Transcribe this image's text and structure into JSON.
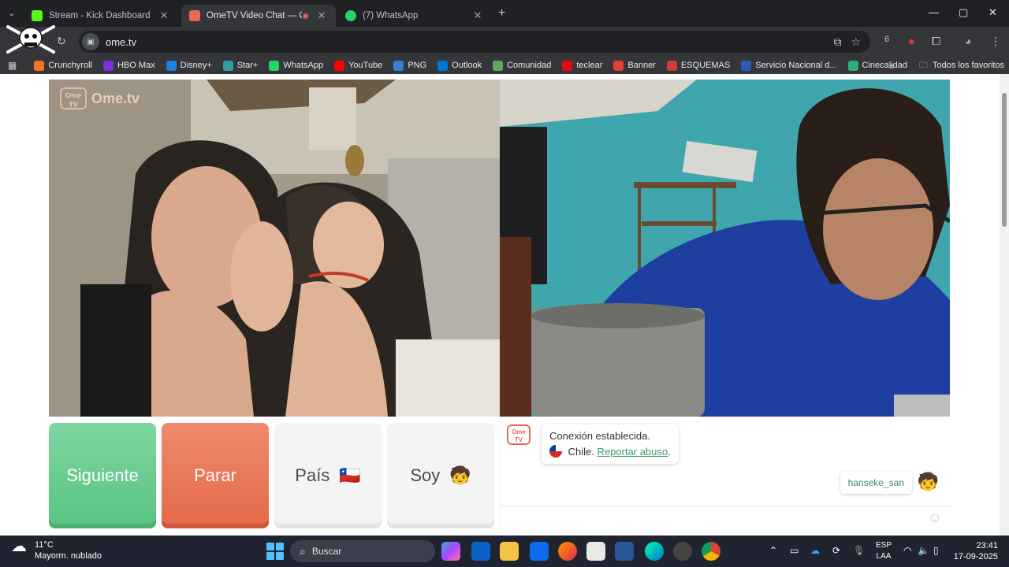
{
  "browser": {
    "tabs": [
      {
        "title": "Stream - Kick Dashboard",
        "color": "#53fc18"
      },
      {
        "title": "OmeTV Video Chat — Ome",
        "color": "#e8665a",
        "active": true
      },
      {
        "title": "(7) WhatsApp",
        "color": "#25d366"
      }
    ],
    "new_tab": "+",
    "url": "ome.tv",
    "window_controls": {
      "minimize": "—",
      "maximize": "▢",
      "close": "✕"
    }
  },
  "bookmarks": [
    {
      "label": "Crunchyroll",
      "color": "#f47521"
    },
    {
      "label": "HBO Max",
      "color": "#7b2fd6"
    },
    {
      "label": "Disney+",
      "color": "#1f80e0"
    },
    {
      "label": "Star+",
      "color": "#2ea0a0"
    },
    {
      "label": "WhatsApp",
      "color": "#25d366"
    },
    {
      "label": "YouTube",
      "color": "#ff0000"
    },
    {
      "label": "PNG",
      "color": "#3a7bd5"
    },
    {
      "label": "Outlook",
      "color": "#0078d4"
    },
    {
      "label": "Comunidad",
      "color": "#5fa85f"
    },
    {
      "label": "teclear",
      "color": "#e50914"
    },
    {
      "label": "Banner",
      "color": "#e43b3b"
    },
    {
      "label": "ESQUEMAS",
      "color": "#d23b3b"
    },
    {
      "label": "Servicio Nacional d...",
      "color": "#2b5bb5"
    },
    {
      "label": "Cinecalidad",
      "color": "#2fb07a"
    }
  ],
  "bookmarks_more": "»",
  "bookmarks_all": "Todos los favoritos",
  "page": {
    "logo_text": "Ome.tv",
    "logo_box": "Ome TV",
    "buttons": {
      "next": "Siguiente",
      "stop": "Parar",
      "country": "País",
      "country_flag": "🇨🇱",
      "me": "Soy",
      "me_emoji": "🧒"
    },
    "chat": {
      "avatar_label": "Ome TV",
      "system_line1": "Conexión establecida.",
      "country": "Chile.",
      "report": "Reportar abuso",
      "report_suffix": ".",
      "user_name": "hanseke_san",
      "user_emoji": "🧒"
    }
  },
  "taskbar": {
    "temperature": "11°C",
    "weather": "Mayorm. nublado",
    "search": "Buscar",
    "lang1": "ESP",
    "lang2": "LAA",
    "time": "23:41",
    "date": "17-09-2025"
  }
}
